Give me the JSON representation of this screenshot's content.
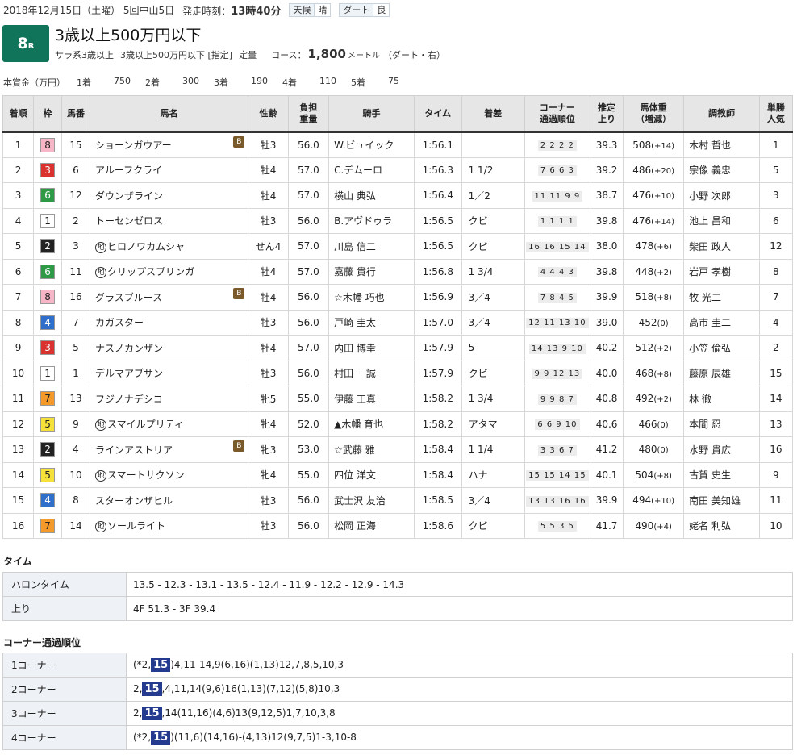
{
  "header": {
    "date": "2018年12月15日（土曜） 5回中山5日",
    "post_label": "発走時刻：",
    "post_time": "13時40分",
    "weather_label": "天候",
    "weather": "晴",
    "track_label": "ダート",
    "track_cond": "良"
  },
  "race": {
    "number": "8",
    "r": "R",
    "title": "3歳以上500万円以下",
    "class1": "サラ系3歳以上",
    "class2": "3歳以上500万円以下 [指定]",
    "weight_rule": "定量",
    "course_label": "コース：",
    "distance": "1,800",
    "meter": "メートル",
    "course_detail": "（ダート・右）"
  },
  "prize": {
    "label": "本賞金（万円）",
    "items": [
      "1着",
      "750",
      "2着",
      "300",
      "3着",
      "190",
      "4着",
      "110",
      "5着",
      "75"
    ]
  },
  "table_headers": [
    "着順",
    "枠",
    "馬番",
    "馬名",
    "性齢",
    "負担\n重量",
    "騎手",
    "タイム",
    "着差",
    "コーナー\n通過順位",
    "推定\n上り",
    "馬体重\n（増減）",
    "調教師",
    "単勝\n人気"
  ],
  "results": [
    {
      "pos": "1",
      "waku": "8",
      "num": "15",
      "chi": "",
      "name": "ショーンガウアー",
      "blink": "B",
      "sexage": "牡3",
      "wt": "56.0",
      "jockey": "W.ビュイック",
      "time": "1:56.1",
      "margin": "",
      "corner": "2 2 2 2",
      "last": "39.3",
      "bw": "508",
      "bwd": "(+14)",
      "trainer": "木村 哲也",
      "pop": "1"
    },
    {
      "pos": "2",
      "waku": "3",
      "num": "6",
      "chi": "",
      "name": "アルーフクライ",
      "blink": "",
      "sexage": "牡4",
      "wt": "57.0",
      "jockey": "C.デムーロ",
      "time": "1:56.3",
      "margin": "1 1/2",
      "corner": "7 6 6 3",
      "last": "39.2",
      "bw": "486",
      "bwd": "(+20)",
      "trainer": "宗像 義忠",
      "pop": "5"
    },
    {
      "pos": "3",
      "waku": "6",
      "num": "12",
      "chi": "",
      "name": "ダウンザライン",
      "blink": "",
      "sexage": "牡4",
      "wt": "57.0",
      "jockey": "横山 典弘",
      "time": "1:56.4",
      "margin": "1／2",
      "corner": "11 11 9 9",
      "last": "38.7",
      "bw": "476",
      "bwd": "(+10)",
      "trainer": "小野 次郎",
      "pop": "3"
    },
    {
      "pos": "4",
      "waku": "1",
      "num": "2",
      "chi": "",
      "name": "トーセンゼロス",
      "blink": "",
      "sexage": "牡3",
      "wt": "56.0",
      "jockey": "B.アヴドゥラ",
      "time": "1:56.5",
      "margin": "クビ",
      "corner": "1 1 1 1",
      "last": "39.8",
      "bw": "476",
      "bwd": "(+14)",
      "trainer": "池上 昌和",
      "pop": "6"
    },
    {
      "pos": "5",
      "waku": "2",
      "num": "3",
      "chi": "地",
      "name": "ヒロノワカムシャ",
      "blink": "",
      "sexage": "せん4",
      "wt": "57.0",
      "jockey": "川島 信二",
      "time": "1:56.5",
      "margin": "クビ",
      "corner": "16 16 15 14",
      "last": "38.0",
      "bw": "478",
      "bwd": "(+6)",
      "trainer": "柴田 政人",
      "pop": "12"
    },
    {
      "pos": "6",
      "waku": "6",
      "num": "11",
      "chi": "地",
      "name": "クリップスプリンガ",
      "blink": "",
      "sexage": "牡4",
      "wt": "57.0",
      "jockey": "嘉藤 貴行",
      "time": "1:56.8",
      "margin": "1 3/4",
      "corner": "4 4 4 3",
      "last": "39.8",
      "bw": "448",
      "bwd": "(+2)",
      "trainer": "岩戸 孝樹",
      "pop": "8"
    },
    {
      "pos": "7",
      "waku": "8",
      "num": "16",
      "chi": "",
      "name": "グラスブルース",
      "blink": "B",
      "sexage": "牡4",
      "wt": "56.0",
      "jockey": "☆木幡 巧也",
      "time": "1:56.9",
      "margin": "3／4",
      "corner": "7 8 4 5",
      "last": "39.9",
      "bw": "518",
      "bwd": "(+8)",
      "trainer": "牧 光二",
      "pop": "7"
    },
    {
      "pos": "8",
      "waku": "4",
      "num": "7",
      "chi": "",
      "name": "カガスター",
      "blink": "",
      "sexage": "牡3",
      "wt": "56.0",
      "jockey": "戸崎 圭太",
      "time": "1:57.0",
      "margin": "3／4",
      "corner": "12 11 13 10",
      "last": "39.0",
      "bw": "452",
      "bwd": "(0)",
      "trainer": "高市 圭二",
      "pop": "4"
    },
    {
      "pos": "9",
      "waku": "3",
      "num": "5",
      "chi": "",
      "name": "ナスノカンザン",
      "blink": "",
      "sexage": "牡4",
      "wt": "57.0",
      "jockey": "内田 博幸",
      "time": "1:57.9",
      "margin": "5",
      "corner": "14 13 9 10",
      "last": "40.2",
      "bw": "512",
      "bwd": "(+2)",
      "trainer": "小笠 倫弘",
      "pop": "2"
    },
    {
      "pos": "10",
      "waku": "1",
      "num": "1",
      "chi": "",
      "name": "デルマアブサン",
      "blink": "",
      "sexage": "牡3",
      "wt": "56.0",
      "jockey": "村田 一誠",
      "time": "1:57.9",
      "margin": "クビ",
      "corner": "9 9 12 13",
      "last": "40.0",
      "bw": "468",
      "bwd": "(+8)",
      "trainer": "藤原 辰雄",
      "pop": "15"
    },
    {
      "pos": "11",
      "waku": "7",
      "num": "13",
      "chi": "",
      "name": "フジノナデシコ",
      "blink": "",
      "sexage": "牝5",
      "wt": "55.0",
      "jockey": "伊藤 工真",
      "time": "1:58.2",
      "margin": "1 3/4",
      "corner": "9 9 8 7",
      "last": "40.8",
      "bw": "492",
      "bwd": "(+2)",
      "trainer": "林 徹",
      "pop": "14"
    },
    {
      "pos": "12",
      "waku": "5",
      "num": "9",
      "chi": "地",
      "name": "スマイルプリティ",
      "blink": "",
      "sexage": "牝4",
      "wt": "52.0",
      "jockey": "▲木幡 育也",
      "time": "1:58.2",
      "margin": "アタマ",
      "corner": "6 6 9 10",
      "last": "40.6",
      "bw": "466",
      "bwd": "(0)",
      "trainer": "本間 忍",
      "pop": "13"
    },
    {
      "pos": "13",
      "waku": "2",
      "num": "4",
      "chi": "",
      "name": "ラインアストリア",
      "blink": "B",
      "sexage": "牝3",
      "wt": "53.0",
      "jockey": "☆武藤 雅",
      "time": "1:58.4",
      "margin": "1 1/4",
      "corner": "3 3 6 7",
      "last": "41.2",
      "bw": "480",
      "bwd": "(0)",
      "trainer": "水野 貴広",
      "pop": "16"
    },
    {
      "pos": "14",
      "waku": "5",
      "num": "10",
      "chi": "地",
      "name": "スマートサクソン",
      "blink": "",
      "sexage": "牝4",
      "wt": "55.0",
      "jockey": "四位 洋文",
      "time": "1:58.4",
      "margin": "ハナ",
      "corner": "15 15 14 15",
      "last": "40.1",
      "bw": "504",
      "bwd": "(+8)",
      "trainer": "古賀 史生",
      "pop": "9"
    },
    {
      "pos": "15",
      "waku": "4",
      "num": "8",
      "chi": "",
      "name": "スターオンザヒル",
      "blink": "",
      "sexage": "牡3",
      "wt": "56.0",
      "jockey": "武士沢 友治",
      "time": "1:58.5",
      "margin": "3／4",
      "corner": "13 13 16 16",
      "last": "39.9",
      "bw": "494",
      "bwd": "(+10)",
      "trainer": "南田 美知雄",
      "pop": "11"
    },
    {
      "pos": "16",
      "waku": "7",
      "num": "14",
      "chi": "地",
      "name": "ソールライト",
      "blink": "",
      "sexage": "牡3",
      "wt": "56.0",
      "jockey": "松岡 正海",
      "time": "1:58.6",
      "margin": "クビ",
      "corner": "5 5 3 5",
      "last": "41.7",
      "bw": "490",
      "bwd": "(+4)",
      "trainer": "姥名 利弘",
      "pop": "10"
    }
  ],
  "waku_colors": {
    "1": {
      "bg": "#ffffff",
      "fg": "#222222"
    },
    "2": {
      "bg": "#222222",
      "fg": "#ffffff"
    },
    "3": {
      "bg": "#d9322f",
      "fg": "#ffffff"
    },
    "4": {
      "bg": "#2f6fc9",
      "fg": "#ffffff"
    },
    "5": {
      "bg": "#f5e13a",
      "fg": "#222222"
    },
    "6": {
      "bg": "#2f9a46",
      "fg": "#ffffff"
    },
    "7": {
      "bg": "#f39a2a",
      "fg": "#222222"
    },
    "8": {
      "bg": "#f7b6c8",
      "fg": "#222222"
    }
  },
  "time_section": {
    "title": "タイム",
    "rows": [
      {
        "k": "ハロンタイム",
        "v": "13.5 - 12.3 - 13.1 - 13.5 - 12.4 - 11.9 - 12.2 - 12.9 - 14.3"
      },
      {
        "k": "上り",
        "v": "4F 51.3 - 3F 39.4"
      }
    ]
  },
  "corner_section": {
    "title": "コーナー通過順位",
    "highlight": "15",
    "rows": [
      {
        "k": "1コーナー",
        "pre": "(*2,",
        "post": ")4,11-14,9(6,16)(1,13)12,7,8,5,10,3"
      },
      {
        "k": "2コーナー",
        "pre": "2,",
        "post": ",4,11,14(9,6)16(1,13)(7,12)(5,8)10,3"
      },
      {
        "k": "3コーナー",
        "pre": "2,",
        "post": ",14(11,16)(4,6)13(9,12,5)1,7,10,3,8"
      },
      {
        "k": "4コーナー",
        "pre": "(*2,",
        "post": ")(11,6)(14,16)-(4,13)12(9,7,5)1-3,10-8"
      }
    ]
  }
}
